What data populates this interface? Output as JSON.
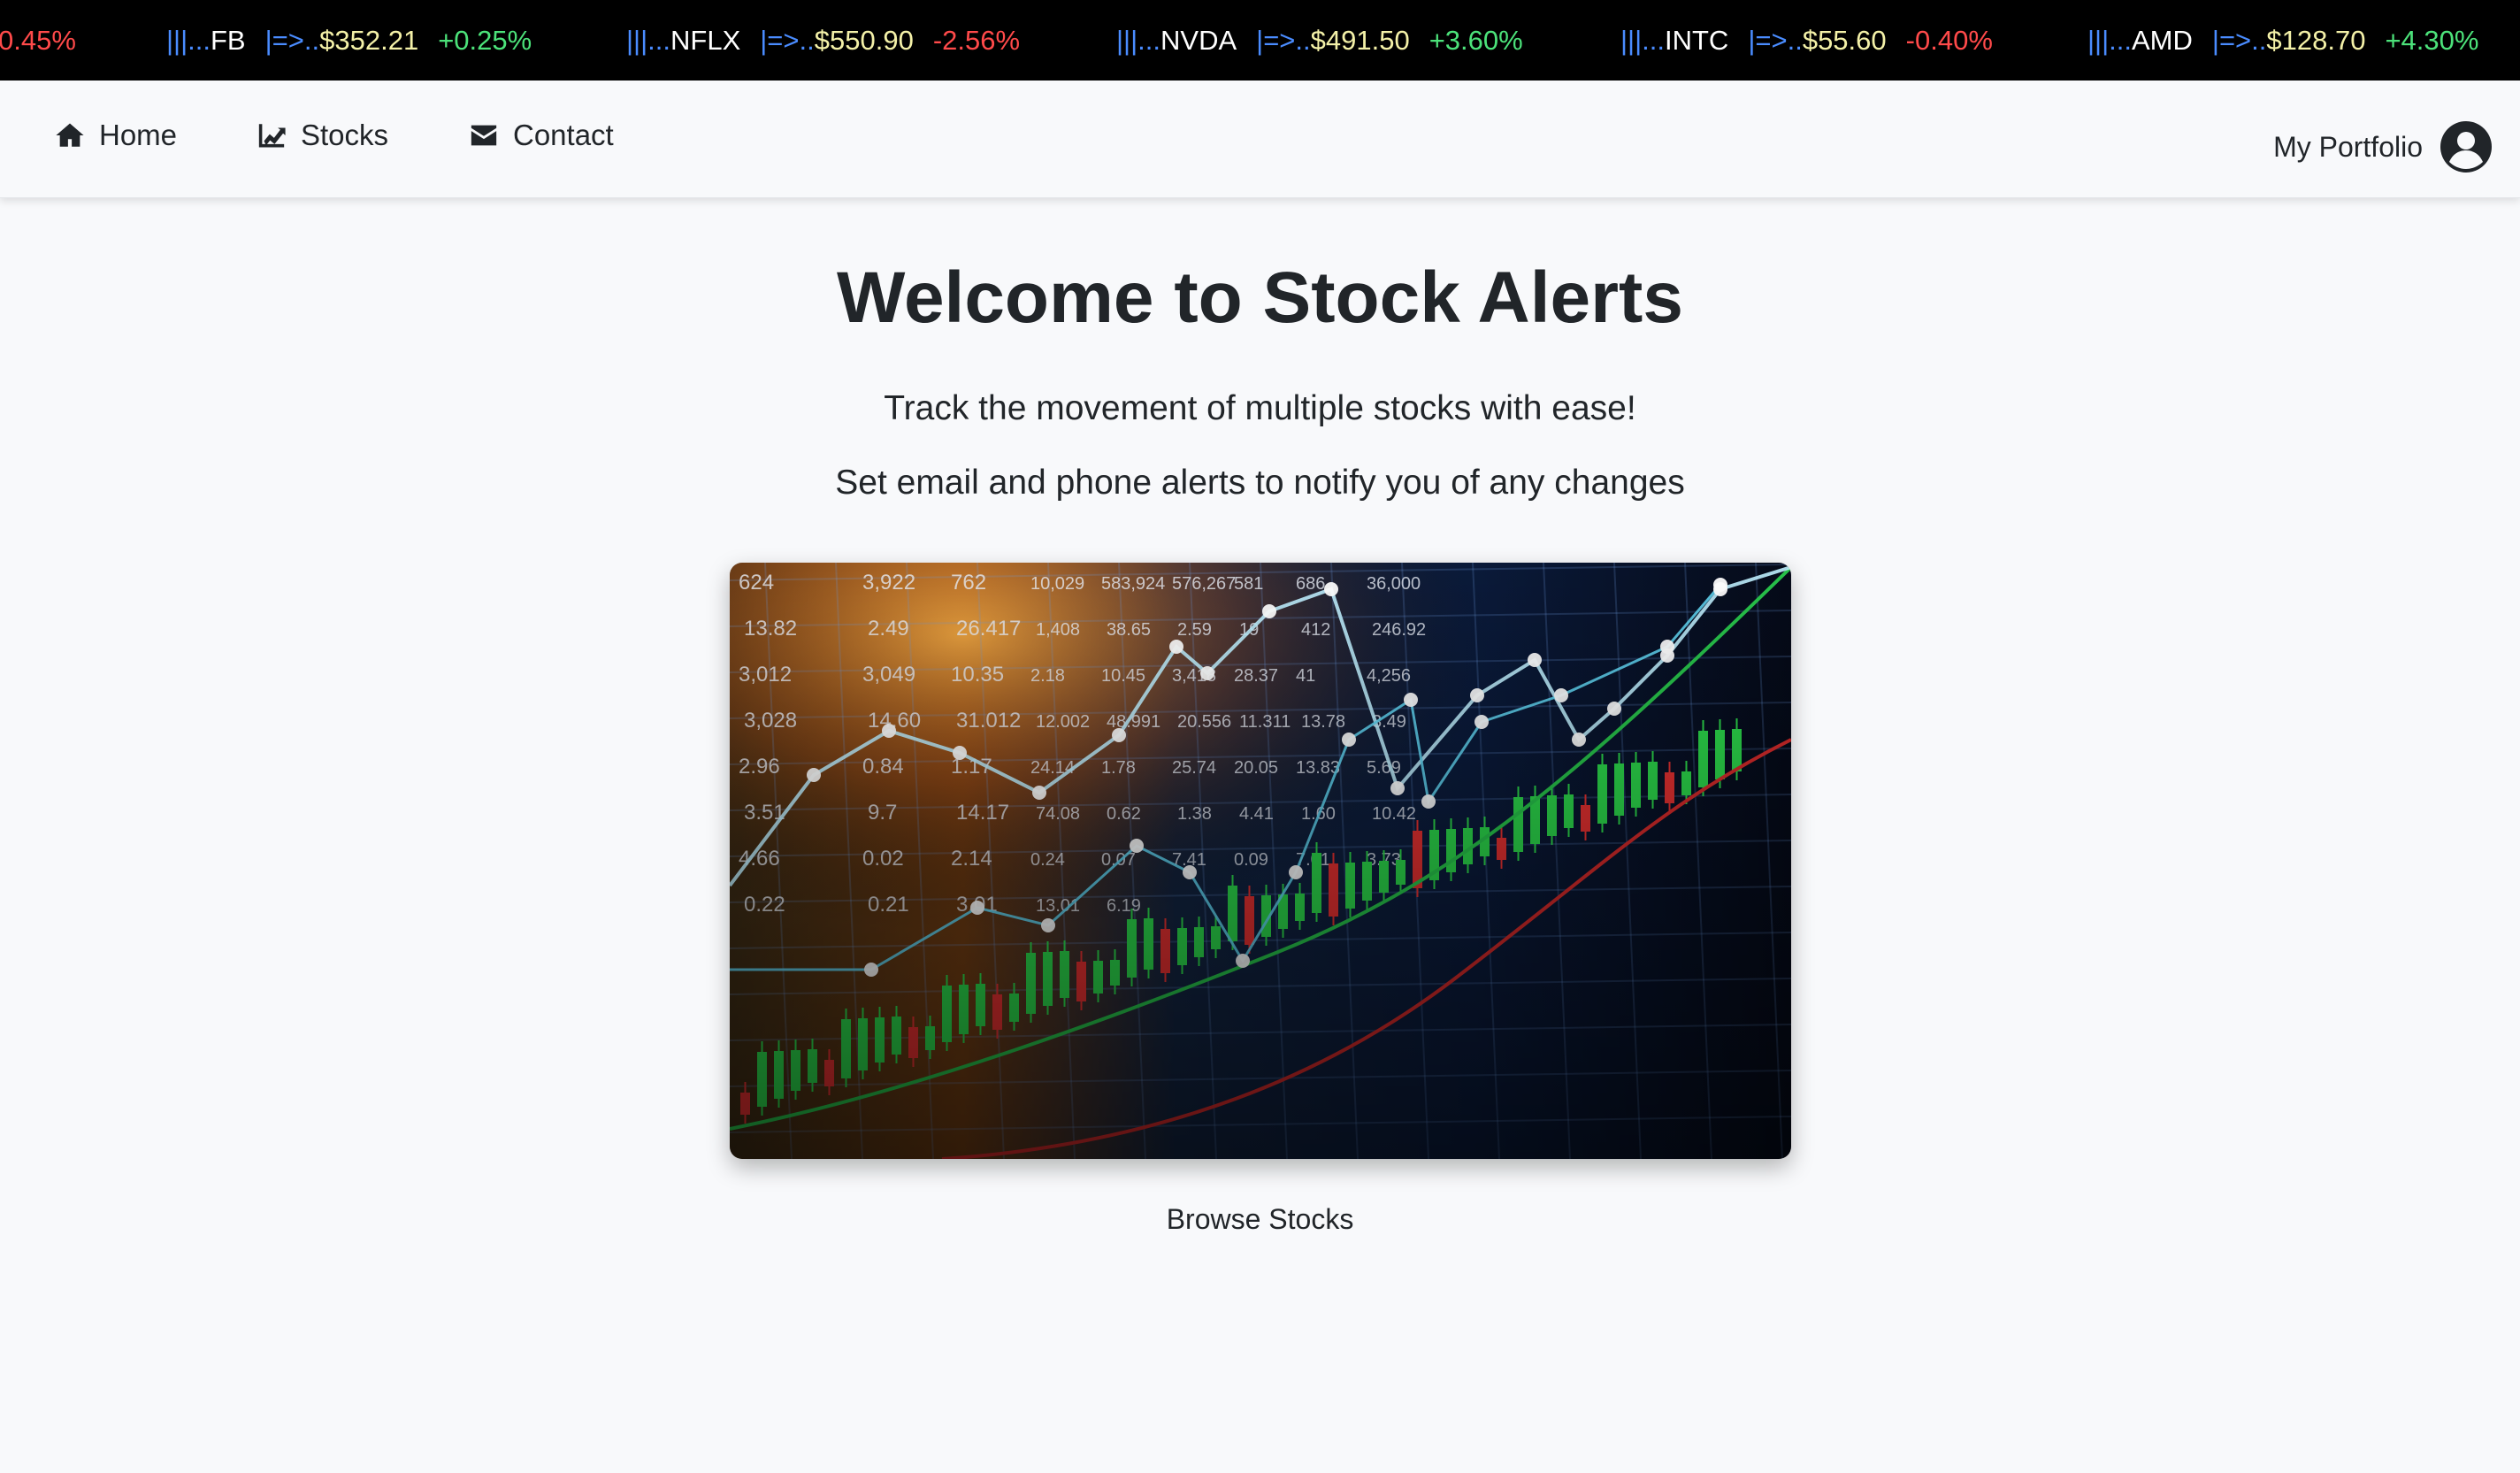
{
  "ticker": [
    {
      "symbol": "",
      "price": "",
      "change": "0.45%",
      "direction": "down",
      "partial": true
    },
    {
      "symbol": "FB",
      "price": "$352.21",
      "change": "+0.25%",
      "direction": "up"
    },
    {
      "symbol": "NFLX",
      "price": "$550.90",
      "change": "-2.56%",
      "direction": "down"
    },
    {
      "symbol": "NVDA",
      "price": "$491.50",
      "change": "+3.60%",
      "direction": "up"
    },
    {
      "symbol": "INTC",
      "price": "$55.60",
      "change": "-0.40%",
      "direction": "down"
    },
    {
      "symbol": "AMD",
      "price": "$128.70",
      "change": "+4.30%",
      "direction": "up"
    }
  ],
  "ticker_decor": {
    "bars": "|||...",
    "arrow": "|=>.."
  },
  "nav": {
    "home": "Home",
    "stocks": "Stocks",
    "contact": "Contact",
    "portfolio": "My Portfolio"
  },
  "hero": {
    "title": "Welcome to Stock Alerts",
    "subtitle": "Track the movement of multiple stocks with ease!",
    "subtitle2": "Set email and phone alerts to notify you of any changes",
    "image_numbers": [
      "624",
      "3,922",
      "762",
      "10,029",
      "583,924",
      "576,267",
      "581",
      "686",
      "36,000",
      "13.82",
      "2.49",
      "26.417",
      "1,408",
      "38.65",
      "2.59",
      "19",
      "412",
      "246.92",
      "3,012",
      "3,049",
      "10.35",
      "2.18",
      "10.45",
      "3,418",
      "28.37",
      "41",
      "4,256",
      "3,028",
      "14.60",
      "31.012",
      "12.002",
      "48.991",
      "20.556",
      "11.311",
      "13.78",
      "3.49",
      "2.96",
      "0.84",
      "1.17",
      "24.14",
      "1.78",
      "25.74",
      "20.05",
      "13.83",
      "5.69",
      "3.51",
      "9.7",
      "14.17",
      "74.08",
      "0.62",
      "1.38",
      "4.41",
      "1.60",
      "10.42",
      "4.66",
      "0.02",
      "2.14",
      "0.24",
      "0.07",
      "7.41",
      "0.09",
      "7.01",
      "3.73",
      "0.22",
      "0.21",
      "3.01",
      "13.01",
      "6.19"
    ],
    "button": "Browse Stocks"
  },
  "colors": {
    "up": "#4ce27a",
    "down": "#ff4a4a",
    "ticker_bg": "#000000",
    "page_bg": "#f8f9fb"
  }
}
